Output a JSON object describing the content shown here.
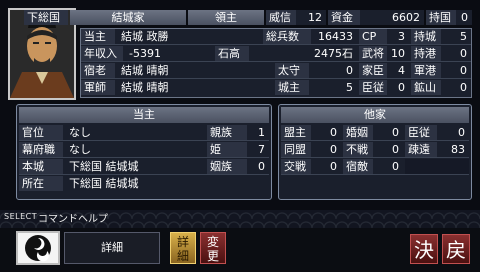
{
  "header": {
    "domain": "下総国",
    "family": "結城家",
    "rank": "領主",
    "prestige_label": "威信",
    "prestige_value": "12",
    "funds_label": "資金",
    "funds_value": "6602",
    "provinces_label": "持国",
    "provinces_value": "0"
  },
  "stats": {
    "lord_label": "当主",
    "lord_name": "結城 政勝",
    "soldiers_label": "総兵数",
    "soldiers_value": "16433",
    "cp_label": "CP",
    "cp_value": "3",
    "castles_label": "持城",
    "castles_value": "5",
    "income_label": "年収入",
    "income_value": "-5391",
    "kokudaka_label": "石高",
    "kokudaka_value": "2475石",
    "warriors_label": "武将",
    "warriors_value": "10",
    "ports_label": "持港",
    "ports_value": "0",
    "elder_label": "宿老",
    "elder_name": "結城 晴朝",
    "tachi_label": "太守",
    "tachi_value": "0",
    "retainer_label": "家臣",
    "retainer_value": "4",
    "port_label": "軍港",
    "port_value": "0",
    "strategist_label": "軍師",
    "strategist_name": "結城 晴朝",
    "lord_castle_label": "城主",
    "lord_castle_value": "5",
    "vassal_label": "臣従",
    "vassal_value": "0",
    "mine_label": "鉱山",
    "mine_value": "0"
  },
  "lord_panel": {
    "title": "当主",
    "rows": [
      {
        "label": "官位",
        "value": "なし",
        "sublabel": "親族",
        "subvalue": "1"
      },
      {
        "label": "幕府職",
        "value": "なし",
        "sublabel": "姫",
        "subvalue": "7"
      },
      {
        "label": "本城",
        "value": "下総国 結城城",
        "sublabel": "姻族",
        "subvalue": "0"
      },
      {
        "label": "所在",
        "value": "下総国 結城城",
        "sublabel": "",
        "subvalue": ""
      }
    ]
  },
  "other_panel": {
    "title": "他家",
    "rows": [
      [
        {
          "label": "盟主",
          "value": "0"
        },
        {
          "label": "婚姻",
          "value": "0"
        },
        {
          "label": "臣従",
          "value": "0"
        }
      ],
      [
        {
          "label": "同盟",
          "value": "0"
        },
        {
          "label": "不戦",
          "value": "0"
        },
        {
          "label": "疎遠",
          "value": "83"
        }
      ],
      [
        {
          "label": "交戦",
          "value": "0"
        },
        {
          "label": "宿敵",
          "value": "0"
        },
        {
          "label": "",
          "value": ""
        }
      ]
    ]
  },
  "command_help": {
    "select_label": "SELECT",
    "help_label": "コマンドヘルプ"
  },
  "bottom": {
    "detail_label": "詳細",
    "btn_detail": "詳細",
    "btn_change": "変更",
    "btn_confirm": "決",
    "btn_back": "戻"
  }
}
